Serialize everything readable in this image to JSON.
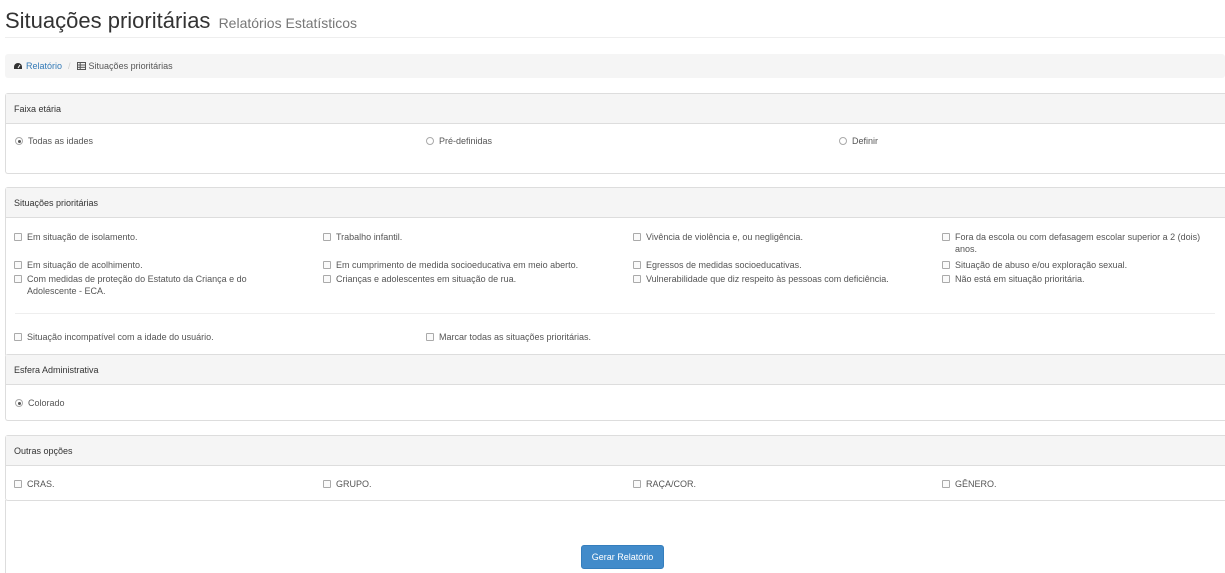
{
  "header": {
    "title": "Situações prioritárias",
    "subtitle": "Relatórios Estatísticos"
  },
  "breadcrumb": {
    "root": "Relatório",
    "current": "Situações prioritárias",
    "root_icon": "dashboard-icon",
    "current_icon": "table-icon"
  },
  "faixa": {
    "heading": "Faixa etária",
    "options": [
      "Todas as idades",
      "Pré-definidas",
      "Definir"
    ],
    "selected": "Todas as idades"
  },
  "situacoes": {
    "heading": "Situações prioritárias",
    "items": [
      "Em situação de isolamento.",
      "Trabalho infantil.",
      "Vivência de violência e, ou negligência.",
      "Fora da escola ou com defasagem escolar superior a 2 (dois) anos.",
      "Em situação de acolhimento.",
      "Em cumprimento de medida socioeducativa em meio aberto.",
      "Egressos de medidas socioeducativas.",
      "Situação de abuso e/ou exploração sexual.",
      "Com medidas de proteção do Estatuto da Criança e do Adolescente - ECA.",
      "Crianças e adolescentes em situação de rua.",
      "Vulnerabilidade que diz respeito às pessoas com deficiência.",
      "Não está em situação prioritária.",
      "Situação incompatível com a idade do usuário.",
      "Marcar todas as situações prioritárias."
    ]
  },
  "esfera": {
    "heading": "Esfera Administrativa",
    "option": "Colorado"
  },
  "outras": {
    "heading": "Outras opções",
    "items": [
      "CRAS.",
      "GRUPO.",
      "RAÇA/COR.",
      "GÊNERO."
    ]
  },
  "actions": {
    "submit_label": "Gerar Relatório"
  }
}
